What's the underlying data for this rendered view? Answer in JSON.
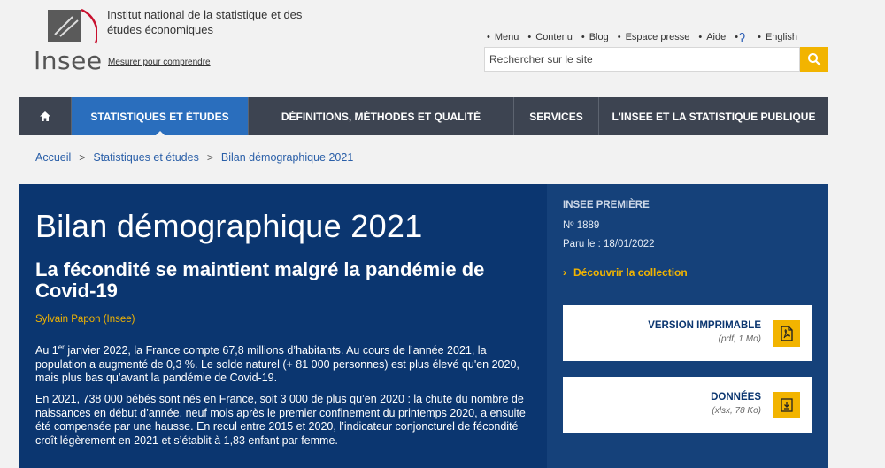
{
  "header": {
    "logo_text": "Insee",
    "org_name": "Institut national de la statistique et des études économiques",
    "tagline": "Mesurer pour comprendre",
    "top_links": [
      "Menu",
      "Contenu",
      "Blog",
      "Espace presse",
      "Aide"
    ],
    "english_label": "English",
    "search_placeholder": "Rechercher sur le site"
  },
  "nav": {
    "items": [
      "STATISTIQUES ET ÉTUDES",
      "DÉFINITIONS, MÉTHODES ET QUALITÉ",
      "SERVICES",
      "L'INSEE ET LA STATISTIQUE PUBLIQUE"
    ]
  },
  "breadcrumb": [
    "Accueil",
    "Statistiques et études",
    "Bilan démographique 2021"
  ],
  "article": {
    "title": "Bilan démographique 2021",
    "subtitle": "La fécondité se maintient malgré la pandémie de Covid-19",
    "author": "Sylvain Papon (Insee)",
    "p1_start": "Au 1",
    "p1_sup": "er",
    "p1_rest": " janvier 2022, la France compte 67,8 millions d’habitants. Au cours de l’année 2021, la population a augmenté de 0,3 %. Le solde naturel (+ 81 000 personnes) est plus élevé qu'en 2020, mais plus bas qu’avant la pandémie de Covid-19.",
    "p2": "En 2021, 738 000 bébés sont nés en France, soit 3 000 de plus qu’en 2020 : la chute du nombre de naissances en début d’année, neuf mois après le premier confinement du printemps 2020, a ensuite été compensée par une hausse. En recul entre 2015 et 2020, l’indicateur conjoncturel de fécondité croît légèrement en 2021 et s’établit à 1,83 enfant par femme."
  },
  "side": {
    "category": "INSEE PREMIÈRE",
    "number": "Nº 1889",
    "date": "Paru le : 18/01/2022",
    "collection_link": "Découvrir la collection",
    "print_title": "VERSION IMPRIMABLE",
    "print_meta": "(pdf, 1 Mo)",
    "data_title": "DONNÉES",
    "data_meta": "(xlsx, 78 Ko)"
  },
  "colors": {
    "accent": "#f2b400",
    "banner": "#0b3670",
    "nav": "#3d4451",
    "nav_active": "#2a6ebd"
  }
}
